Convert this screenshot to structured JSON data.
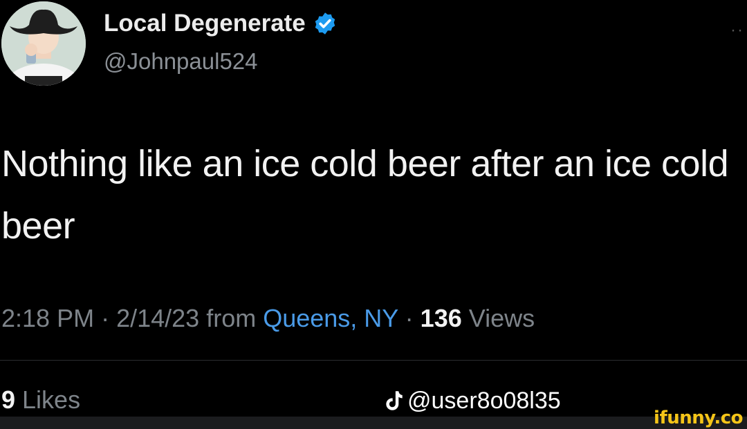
{
  "author": {
    "display_name": "Local Degenerate",
    "handle": "@Johnpaul524",
    "verified_icon": "verified-badge-icon",
    "avatar_icon": "cowboy-avatar"
  },
  "tweet": {
    "text": "Nothing like an ice cold beer after an ice cold beer",
    "time": "2:18 PM",
    "sep1": " · ",
    "date": "2/14/23",
    "from_label": " from ",
    "location": "Queens, NY",
    "sep2": " · ",
    "views_count": "136",
    "views_label": " Views"
  },
  "stats": {
    "likes_count": "9",
    "likes_label": " Likes"
  },
  "watermarks": {
    "tiktok_handle": "@user8o08l35",
    "tiktok_icon": "tiktok-icon",
    "ifunny": "ifunny.co"
  },
  "colors": {
    "background": "#000000",
    "link": "#4a9be8",
    "verified": "#1d9bf0",
    "muted": "#7e848a",
    "ifunny": "#f5c518"
  }
}
